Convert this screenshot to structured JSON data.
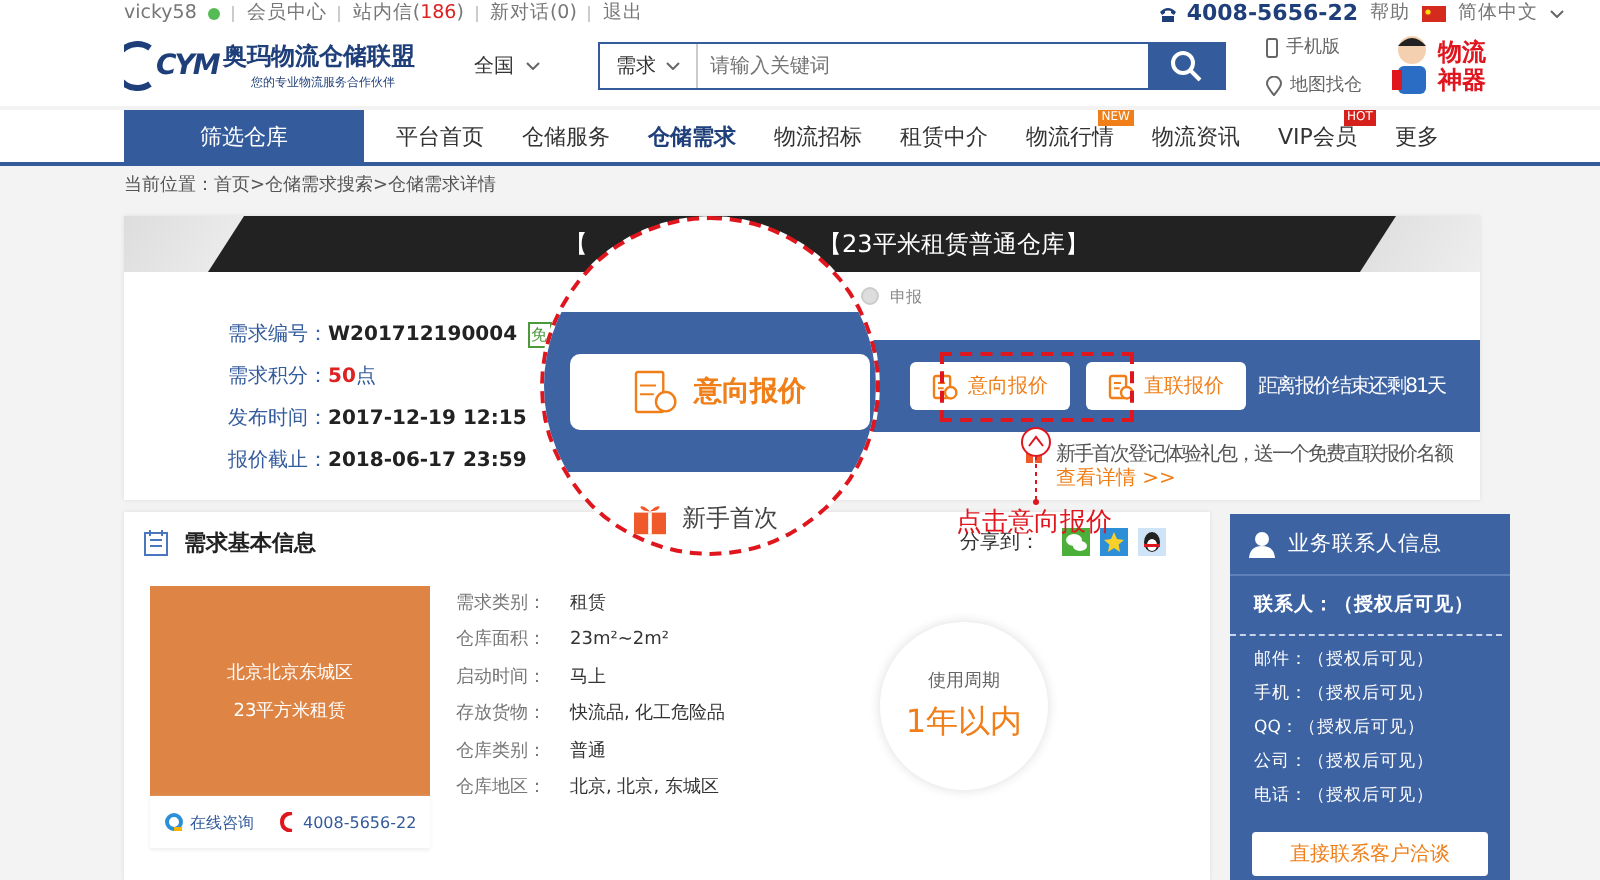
{
  "top_bar": {
    "user": "vicky58",
    "links": [
      {
        "label": "会员中心"
      },
      {
        "label": "站内信(",
        "count": "186",
        "suffix": ")"
      },
      {
        "label": "新对话(0)"
      },
      {
        "label": "退出"
      }
    ],
    "hotline": "4008-5656-22",
    "help": "帮助",
    "language": "简体中文"
  },
  "header": {
    "logo_mark": "CYM",
    "logo_name": "奥玛物流仓储联盟",
    "logo_tagline": "您的专业物流服务合作伙伴",
    "region": "全国",
    "search": {
      "category": "需求",
      "placeholder": "请输入关键词"
    },
    "quick_links": [
      "手机版",
      "地图找仓"
    ],
    "promo": "物流神器"
  },
  "nav": {
    "filter_button": "筛选仓库",
    "items": [
      {
        "label": "平台首页",
        "selected": false
      },
      {
        "label": "仓储服务",
        "selected": false
      },
      {
        "label": "仓储需求",
        "selected": true
      },
      {
        "label": "物流招标",
        "selected": false
      },
      {
        "label": "租赁中介",
        "selected": false
      },
      {
        "label": "物流行情",
        "selected": false,
        "badge": "NEW"
      },
      {
        "label": "物流资讯",
        "selected": false
      },
      {
        "label": "VIP会员",
        "selected": false,
        "badge": "HOT"
      },
      {
        "label": "更多",
        "selected": false
      }
    ]
  },
  "breadcrumb": "当前位置：首页>仓储需求搜索>仓储需求详情",
  "demand": {
    "title_start": "【",
    "title_end": "【23平米租赁普通仓库】",
    "facts": [
      {
        "label": "需求编号：",
        "value": "W201712190004",
        "badge": "免"
      },
      {
        "label": "需求积分：",
        "value": "50",
        "unit": "点"
      },
      {
        "label": "发布时间：",
        "value": "2017-12-19 12:15"
      },
      {
        "label": "报价截止：",
        "value": "2018-06-17 23:59"
      }
    ],
    "step": "申报",
    "actions": [
      "意向报价",
      "直联报价"
    ],
    "countdown": "距离报价结束还剩81天",
    "gift_note": "新手首次登记体验礼包，送一个免费直联报价名额",
    "gift_link": "查看详情 >>"
  },
  "magnifier": {
    "button": "意向报价",
    "gift_text": "新手首次"
  },
  "callout": {
    "text": "点击意向报价"
  },
  "basic_info": {
    "title": "需求基本信息",
    "share_label": "分享到：",
    "tile": {
      "line_1": "北京北京东城区",
      "line_2": "23平方米租赁"
    },
    "consult": "在线咨询",
    "phone": "4008-5656-22",
    "fields": [
      {
        "label": "需求类别：",
        "value": "租赁"
      },
      {
        "label": "仓库面积：",
        "value": "23m²~2m²"
      },
      {
        "label": "启动时间：",
        "value": "马上"
      },
      {
        "label": "存放货物：",
        "value": "快流品, 化工危险品"
      },
      {
        "label": "仓库类别：",
        "value": "普通"
      },
      {
        "label": "仓库地区：",
        "value": "北京, 北京, 东城区"
      }
    ],
    "period": {
      "label": "使用周期",
      "value": "1年以内"
    }
  },
  "contact": {
    "title": "业务联系人信息",
    "person": "联系人：（授权后可见）",
    "fields": [
      "邮件：（授权后可见）",
      "手机：（授权后可见）",
      "QQ：（授权后可见）",
      "公司：（授权后可见）",
      "电话：（授权后可见）"
    ],
    "button": "直接联系客户洽谈"
  }
}
